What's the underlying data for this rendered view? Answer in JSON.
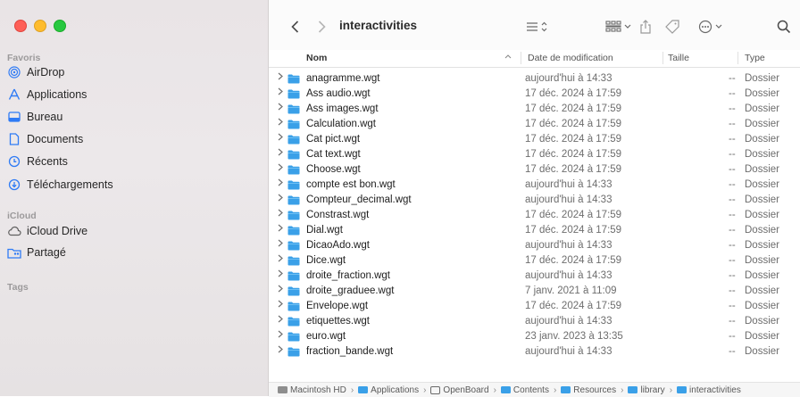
{
  "window": {
    "title": "interactivities"
  },
  "sidebar": {
    "favorites_title": "Favoris",
    "favorites": [
      {
        "label": "AirDrop",
        "icon": "airdrop-icon"
      },
      {
        "label": "Applications",
        "icon": "applications-icon"
      },
      {
        "label": "Bureau",
        "icon": "desktop-icon"
      },
      {
        "label": "Documents",
        "icon": "document-icon"
      },
      {
        "label": "Récents",
        "icon": "clock-icon"
      },
      {
        "label": "Téléchargements",
        "icon": "download-icon"
      }
    ],
    "icloud_title": "iCloud",
    "icloud": [
      {
        "label": "iCloud Drive",
        "icon": "cloud-icon"
      },
      {
        "label": "Partagé",
        "icon": "shared-folder-icon"
      }
    ],
    "tags_title": "Tags"
  },
  "columns": {
    "name": "Nom",
    "date": "Date de modification",
    "size": "Taille",
    "type": "Type"
  },
  "files": [
    {
      "name": "anagramme.wgt",
      "date": "aujourd'hui à 14:33",
      "size": "--",
      "type": "Dossier"
    },
    {
      "name": "Ass audio.wgt",
      "date": "17 déc. 2024 à 17:59",
      "size": "--",
      "type": "Dossier"
    },
    {
      "name": "Ass images.wgt",
      "date": "17 déc. 2024 à 17:59",
      "size": "--",
      "type": "Dossier"
    },
    {
      "name": "Calculation.wgt",
      "date": "17 déc. 2024 à 17:59",
      "size": "--",
      "type": "Dossier"
    },
    {
      "name": "Cat pict.wgt",
      "date": "17 déc. 2024 à 17:59",
      "size": "--",
      "type": "Dossier"
    },
    {
      "name": "Cat text.wgt",
      "date": "17 déc. 2024 à 17:59",
      "size": "--",
      "type": "Dossier"
    },
    {
      "name": "Choose.wgt",
      "date": "17 déc. 2024 à 17:59",
      "size": "--",
      "type": "Dossier"
    },
    {
      "name": "compte est bon.wgt",
      "date": "aujourd'hui à 14:33",
      "size": "--",
      "type": "Dossier"
    },
    {
      "name": "Compteur_decimal.wgt",
      "date": "aujourd'hui à 14:33",
      "size": "--",
      "type": "Dossier"
    },
    {
      "name": "Constrast.wgt",
      "date": "17 déc. 2024 à 17:59",
      "size": "--",
      "type": "Dossier"
    },
    {
      "name": "Dial.wgt",
      "date": "17 déc. 2024 à 17:59",
      "size": "--",
      "type": "Dossier"
    },
    {
      "name": "DicaoAdo.wgt",
      "date": "aujourd'hui à 14:33",
      "size": "--",
      "type": "Dossier"
    },
    {
      "name": "Dice.wgt",
      "date": "17 déc. 2024 à 17:59",
      "size": "--",
      "type": "Dossier"
    },
    {
      "name": "droite_fraction.wgt",
      "date": "aujourd'hui à 14:33",
      "size": "--",
      "type": "Dossier"
    },
    {
      "name": "droite_graduee.wgt",
      "date": "7 janv. 2021 à 11:09",
      "size": "--",
      "type": "Dossier"
    },
    {
      "name": "Envelope.wgt",
      "date": "17 déc. 2024 à 17:59",
      "size": "--",
      "type": "Dossier"
    },
    {
      "name": "etiquettes.wgt",
      "date": "aujourd'hui à 14:33",
      "size": "--",
      "type": "Dossier"
    },
    {
      "name": "euro.wgt",
      "date": "23 janv. 2023 à 13:35",
      "size": "--",
      "type": "Dossier"
    },
    {
      "name": "fraction_bande.wgt",
      "date": "aujourd'hui à 14:33",
      "size": "--",
      "type": "Dossier"
    }
  ],
  "pathbar": [
    {
      "label": "Macintosh HD",
      "icon": "hard-drive-icon"
    },
    {
      "label": "Applications",
      "icon": "folder-icon"
    },
    {
      "label": "OpenBoard",
      "icon": "app-icon"
    },
    {
      "label": "Contents",
      "icon": "folder-icon"
    },
    {
      "label": "Resources",
      "icon": "folder-icon"
    },
    {
      "label": "library",
      "icon": "folder-icon"
    },
    {
      "label": "interactivities",
      "icon": "folder-icon"
    }
  ],
  "colors": {
    "accent": "#2f7bf5",
    "folder": "#3aa0e8"
  }
}
